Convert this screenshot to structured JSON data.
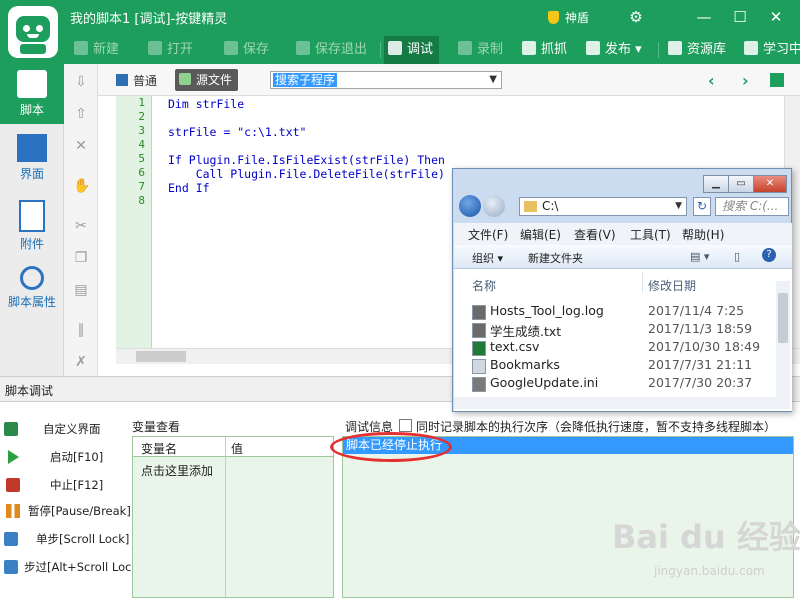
{
  "window": {
    "title": "我的脚本1 [调试]-按键精灵",
    "shield_label": "神盾",
    "controls": [
      "⚙",
      "—",
      "☐",
      "✕"
    ]
  },
  "toolbar": {
    "new": "新建",
    "open": "打开",
    "save": "保存",
    "save_exit": "保存退出",
    "debug": "调试",
    "record": "录制",
    "grab": "抓抓",
    "publish": "发布",
    "resources": "资源库",
    "learn": "学习中"
  },
  "leftnav": {
    "items": [
      {
        "label": "脚本",
        "icon": "script-icon"
      },
      {
        "label": "界面",
        "icon": "layout-icon"
      },
      {
        "label": "附件",
        "icon": "attachment-icon"
      },
      {
        "label": "脚本属性",
        "icon": "info-icon"
      }
    ]
  },
  "editor": {
    "mode_normal": "普通",
    "mode_source": "源文件",
    "subroutine_select": "搜索子程序",
    "line_numbers": [
      "1",
      "2",
      "3",
      "4",
      "5",
      "6",
      "7",
      "8"
    ],
    "code": "Dim strFile\n\nstrFile = \"c:\\1.txt\"\n\nIf Plugin.File.IsFileExist(strFile) Then\n    Call Plugin.File.DeleteFile(strFile)\nEnd If\n"
  },
  "debug": {
    "section_title": "脚本调试",
    "buttons": [
      {
        "label": "自定义界面",
        "icon": "custom-ui-icon"
      },
      {
        "label": "启动[F10]",
        "icon": "play-icon"
      },
      {
        "label": "中止[F12]",
        "icon": "stop-icon"
      },
      {
        "label": "暂停[Pause/Break]",
        "icon": "pause-icon"
      },
      {
        "label": "单步[Scroll Lock]",
        "icon": "step-icon"
      },
      {
        "label": "步过[Alt+Scroll Lock]",
        "icon": "step-over-icon"
      }
    ],
    "var_view_label": "变量查看",
    "var_columns": {
      "name": "变量名",
      "value": "值"
    },
    "var_add": "点击这里添加",
    "info_label": "调试信息",
    "record_order_label": "同时记录脚本的执行次序（会降低执行速度，暂不支持多线程脚本）",
    "log_lines": [
      "脚本已经停止执行"
    ]
  },
  "explorer": {
    "path": "C:\\",
    "search_placeholder": "搜索 C:(...",
    "menu": [
      "文件(F)",
      "编辑(E)",
      "查看(V)",
      "工具(T)",
      "帮助(H)"
    ],
    "cmd_organize": "组织 ▾",
    "cmd_new_folder": "新建文件夹",
    "col_name": "名称",
    "col_date": "修改日期",
    "files": [
      {
        "name": "Hosts_Tool_log.log",
        "date": "2017/11/4 7:25",
        "icon_color": "#6a6a6a"
      },
      {
        "name": "学生成绩.txt",
        "date": "2017/11/3 18:59",
        "icon_color": "#6a6a6a"
      },
      {
        "name": "text.csv",
        "date": "2017/10/30 18:49",
        "icon_color": "#1f7a3a"
      },
      {
        "name": "Bookmarks",
        "date": "2017/7/31 21:11",
        "icon_color": "#d0d8e2"
      },
      {
        "name": "GoogleUpdate.ini",
        "date": "2017/7/30 20:37",
        "icon_color": "#7a7a7a"
      }
    ]
  },
  "watermark": {
    "main": "Bai du 经验",
    "sub": "jingyan.baidu.com"
  }
}
